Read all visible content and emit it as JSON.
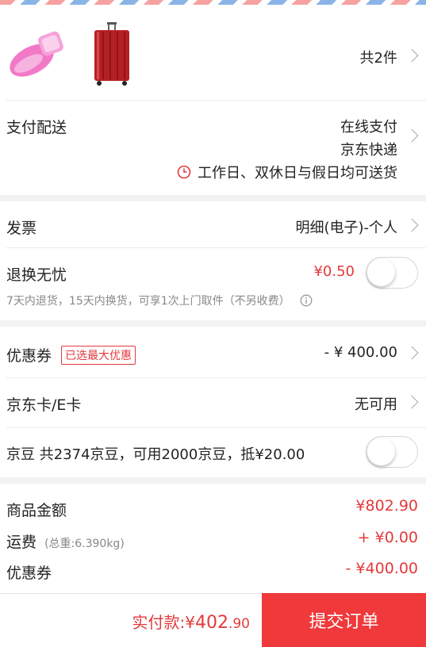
{
  "products": {
    "count_label": "共2件"
  },
  "payment": {
    "label": "支付配送",
    "method": "在线支付",
    "courier": "京东快递",
    "delivery_note": "工作日、双休日与假日均可送货"
  },
  "invoice": {
    "label": "发票",
    "value": "明细(电子)-个人"
  },
  "return_service": {
    "label": "退换无忧",
    "price": "¥0.50",
    "note": "7天内退货，15天内换货，可享1次上门取件（不另收费）",
    "enabled": false
  },
  "coupon": {
    "label": "优惠券",
    "badge": "已选最大优惠",
    "value": "- ¥ 400.00"
  },
  "jd_card": {
    "label": "京东卡/E卡",
    "value": "无可用"
  },
  "jd_beans": {
    "label": "京豆  共2374京豆，可用2000京豆，抵¥20.00",
    "enabled": false
  },
  "summary": {
    "goods_label": "商品金额",
    "goods_value": "¥802.90",
    "shipping_label": "运费",
    "shipping_weight": "(总重:6.390kg)",
    "shipping_value": "+ ¥0.00",
    "coupon_label": "优惠券",
    "coupon_value": "- ¥400.00"
  },
  "footer": {
    "pay_label": "实付款:¥",
    "pay_integer": "402",
    "pay_decimal": ".90",
    "submit_label": "提交订单"
  },
  "colors": {
    "accent": "#e4393c",
    "submit_bg": "#f0393b"
  }
}
